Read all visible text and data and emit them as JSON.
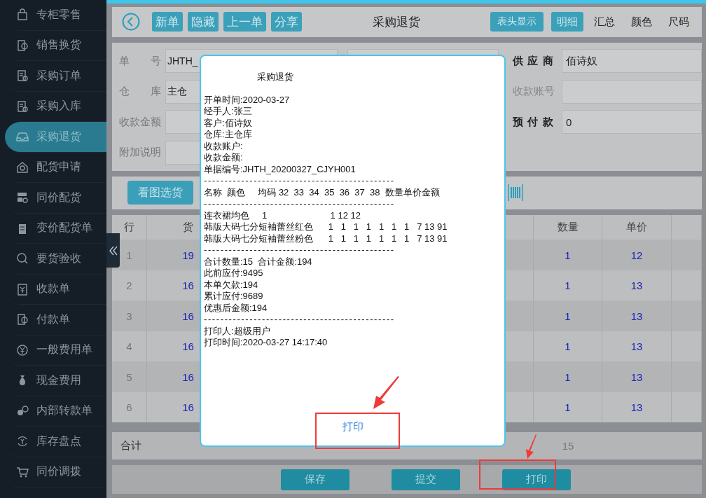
{
  "sidebar": {
    "items": [
      {
        "label": "专柜零售",
        "selected": false
      },
      {
        "label": "销售换货",
        "selected": false
      },
      {
        "label": "采购订单",
        "selected": false
      },
      {
        "label": "采购入库",
        "selected": false
      },
      {
        "label": "采购退货",
        "selected": true
      },
      {
        "label": "配货申请",
        "selected": false
      },
      {
        "label": "同价配货",
        "selected": false
      },
      {
        "label": "变价配货单",
        "selected": false
      },
      {
        "label": "要货验收",
        "selected": false
      },
      {
        "label": "收款单",
        "selected": false
      },
      {
        "label": "付款单",
        "selected": false
      },
      {
        "label": "一般费用单",
        "selected": false
      },
      {
        "label": "现金费用",
        "selected": false
      },
      {
        "label": "内部转款单",
        "selected": false
      },
      {
        "label": "库存盘点",
        "selected": false
      },
      {
        "label": "同价调拨",
        "selected": false
      }
    ]
  },
  "toolbar": {
    "actions": [
      "新单",
      "隐藏",
      "上一单",
      "分享"
    ],
    "title": "采购退货",
    "header_button": "表头显示",
    "view_tabs": [
      {
        "label": "明细",
        "selected": true
      },
      {
        "label": "汇总",
        "selected": false
      },
      {
        "label": "颜色",
        "selected": false
      },
      {
        "label": "尺码",
        "selected": false
      }
    ]
  },
  "form": {
    "left": [
      {
        "label": "单 号",
        "value": "JHTH_"
      },
      {
        "label": "仓 库",
        "value": "主仓"
      },
      {
        "label": "收款金额"
      },
      {
        "label": "附加说明"
      }
    ],
    "right": [
      {
        "label": "供 应 商",
        "value": "佰诗奴",
        "bold": true
      },
      {
        "label": "收款账号",
        "bold": false
      },
      {
        "label": "预 付 款",
        "value": "0",
        "bold": true
      }
    ]
  },
  "select_button": "看图选货",
  "table": {
    "columns": [
      "行",
      "货",
      "数量",
      "单价"
    ],
    "rows": [
      {
        "row": "1",
        "item_no": "19",
        "qty": "1",
        "price": "12"
      },
      {
        "row": "2",
        "item_no": "16",
        "qty": "1",
        "price": "13"
      },
      {
        "row": "3",
        "item_no": "16",
        "qty": "1",
        "price": "13"
      },
      {
        "row": "4",
        "item_no": "16",
        "qty": "1",
        "price": "13"
      },
      {
        "row": "5",
        "item_no": "16",
        "qty": "1",
        "price": "13"
      },
      {
        "row": "6",
        "item_no": "16",
        "qty": "1",
        "price": "13"
      }
    ],
    "total": {
      "label": "合计",
      "qty": "15"
    }
  },
  "bottom_buttons": [
    "保存",
    "提交",
    "打印"
  ],
  "dialog": {
    "title": "采购退货",
    "lines": [
      "开单时间:2020-03-27",
      "经手人:张三",
      "客户:佰诗奴",
      "仓库:主仓库",
      "收款账户:",
      "收款金额:",
      "单据编号:JHTH_20200327_CJYH001",
      "----------------------------------------------",
      "名称  颜色     均码 32  33  34  35  36  37  38  数量单价金额",
      "----------------------------------------------",
      "连衣裙均色     1                         1 12 12",
      "韩版大码七分短袖蕾丝红色      1   1   1   1   1   1   1   7 13 91",
      "韩版大码七分短袖蕾丝粉色      1   1   1   1   1   1   1   7 13 91",
      "----------------------------------------------",
      "合计数量:15  合计金额:194",
      "此前应付:9495",
      "本单欠款:194",
      "累计应付:9689",
      "优惠后金额:194",
      "----------------------------------------------",
      "打印人:超级用户",
      "打印时间:2020-03-27 14:17:40"
    ],
    "button": "打印"
  }
}
